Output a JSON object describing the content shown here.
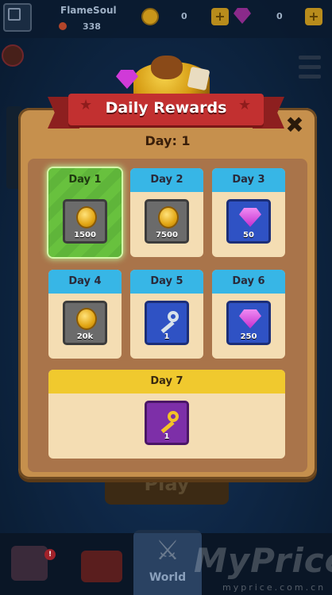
{
  "player": {
    "name": "FlameSoul",
    "level": "338"
  },
  "currency": {
    "coins": "0",
    "gems": "0",
    "plus": "+"
  },
  "modal": {
    "title": "Daily Rewards",
    "current_day": "Day: 1",
    "close": "✖"
  },
  "rewards": [
    {
      "day": "Day 1",
      "item": "coin-icon",
      "amount": "1500",
      "tile": "grey",
      "state": "claimable"
    },
    {
      "day": "Day 2",
      "item": "coin-icon",
      "amount": "7500",
      "tile": "grey",
      "state": "locked"
    },
    {
      "day": "Day 3",
      "item": "gem-icon",
      "amount": "50",
      "tile": "blue",
      "state": "locked"
    },
    {
      "day": "Day 4",
      "item": "coin-icon",
      "amount": "20k",
      "tile": "grey",
      "state": "locked"
    },
    {
      "day": "Day 5",
      "item": "silver-key-icon",
      "amount": "1",
      "tile": "blue",
      "state": "locked"
    },
    {
      "day": "Day 6",
      "item": "gem-icon",
      "amount": "250",
      "tile": "blue",
      "state": "locked"
    },
    {
      "day": "Day 7",
      "item": "gold-key-icon",
      "amount": "1",
      "tile": "purple",
      "state": "locked"
    }
  ],
  "background": {
    "play_label": "Play",
    "notification_count": "!"
  },
  "nav": {
    "world_label": "World"
  },
  "watermark": {
    "brand": "MyPrice",
    "url": "myprice.com.cn"
  },
  "colors": {
    "modal_bg": "#c6904d",
    "ribbon": "#c23030",
    "day_header_blue": "#37b6e6",
    "day_active_green": "#68c13e",
    "day7_header_yellow": "#f0c92e"
  }
}
